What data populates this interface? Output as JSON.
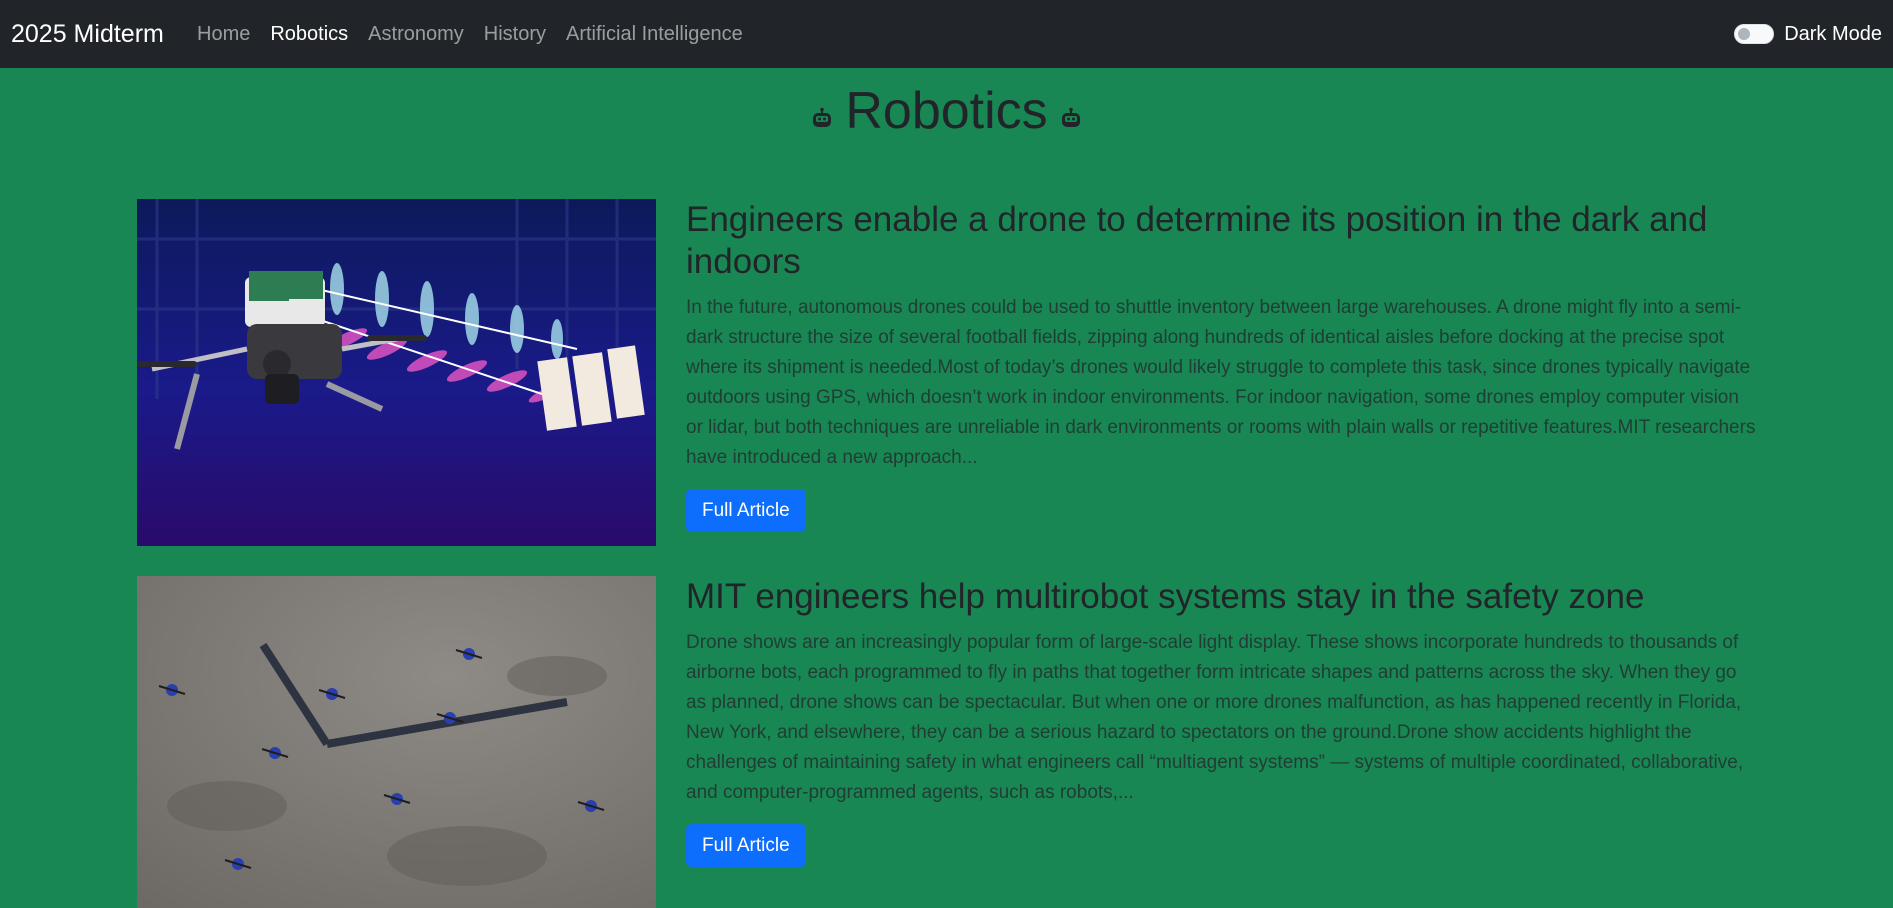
{
  "navbar": {
    "brand": "2025 Midterm",
    "links": [
      "Home",
      "Robotics",
      "Astronomy",
      "History",
      "Artificial Intelligence"
    ],
    "active": "Robotics",
    "dark_mode_label": "Dark Mode",
    "dark_mode_on": false
  },
  "page": {
    "title": "Robotics",
    "icon": "robot-icon"
  },
  "articles": [
    {
      "title": "Engineers enable a drone to determine its position in the dark and indoors",
      "summary": "In the future, autonomous drones could be used to shuttle inventory between large warehouses. A drone might fly into a semi-dark structure the size of several football fields, zipping along hundreds of identical aisles before docking at the precise spot where its shipment is needed.Most of today’s drones would likely struggle to complete this task, since drones typically navigate outdoors using GPS, which doesn’t work in indoor environments. For indoor navigation, some drones employ computer vision or lidar, but both techniques are unreliable in dark environments or rooms with plain walls or repetitive features.MIT researchers have introduced a new approach...",
      "button": "Full Article",
      "image": "drone-signal-illustration"
    },
    {
      "title": "MIT engineers help multirobot systems stay in the safety zone",
      "summary": "Drone shows are an increasingly popular form of large-scale light display. These shows incorporate hundreds to thousands of airborne bots, each programmed to fly in paths that together form intricate shapes and patterns across the sky. When they go as planned, drone shows can be spectacular. But when one or more drones malfunction, as has happened recently in Florida, New York, and elsewhere, they can be a serious hazard to spectators on the ground.Drone show accidents highlight the challenges of maintaining safety in what engineers call “multiagent systems” — systems of multiple coordinated, collaborative, and computer-programmed agents, such as robots,...",
      "button": "Full Article",
      "image": "drones-on-floor-photo"
    }
  ],
  "colors": {
    "background": "#198754",
    "navbar": "#212529",
    "button": "#0d6efd"
  }
}
